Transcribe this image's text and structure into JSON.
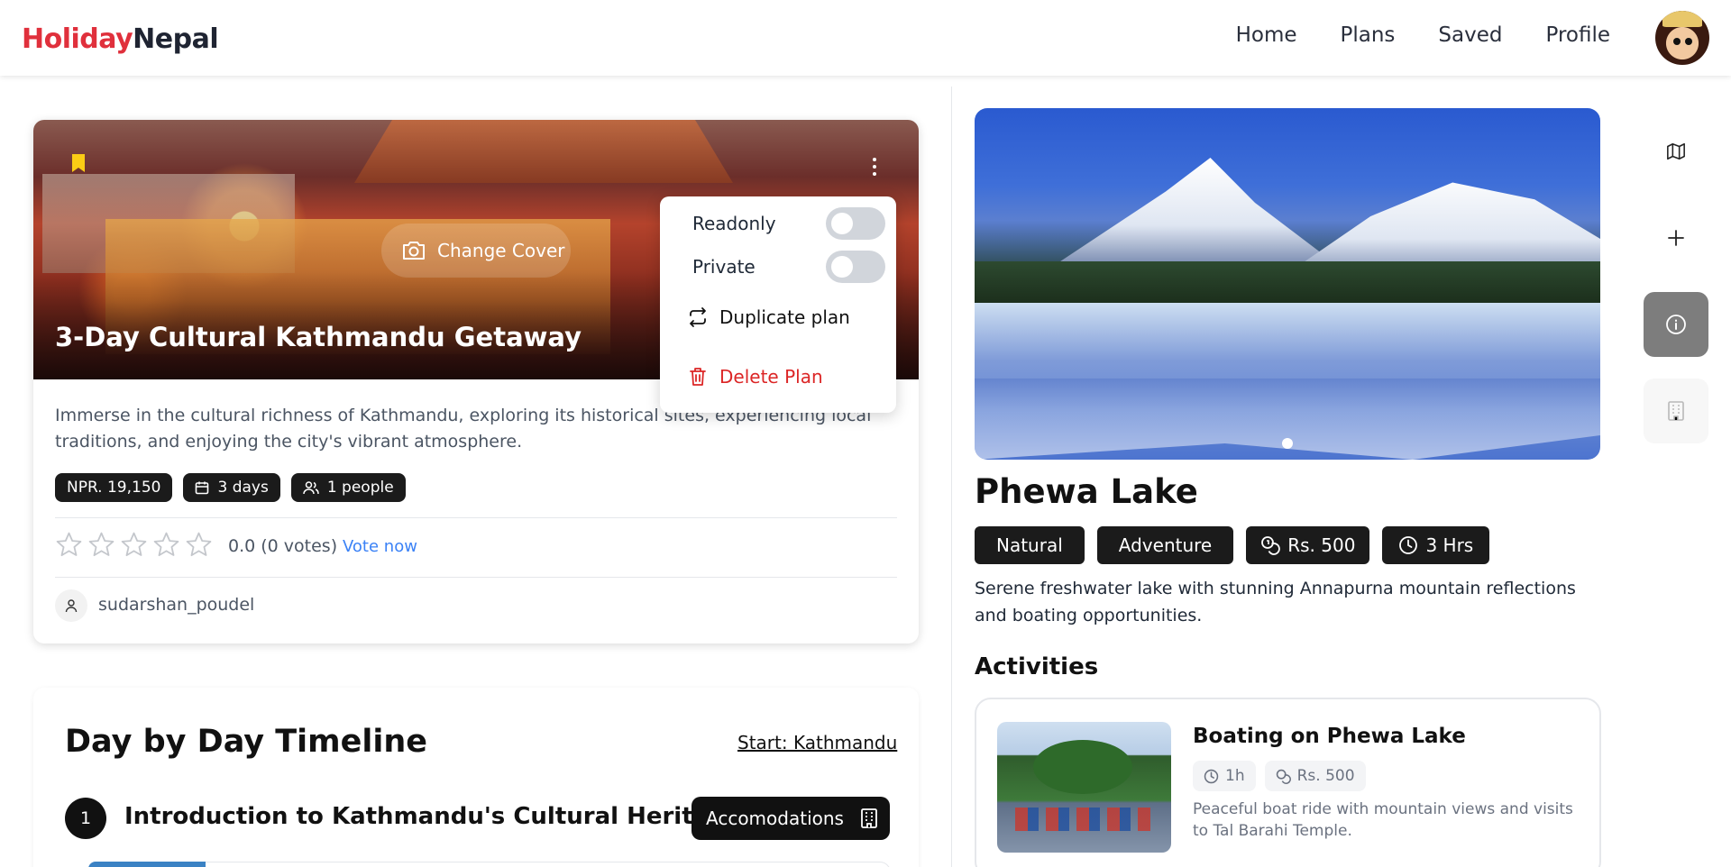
{
  "app": {
    "brand_part1": "Holiday",
    "brand_part2": "Nepal",
    "brand_red": "#e0303c"
  },
  "nav": {
    "items": [
      "Home",
      "Plans",
      "Saved",
      "Profile"
    ]
  },
  "plan": {
    "change_cover_label": "Change Cover",
    "title": "3-Day Cultural Kathmandu Getaway",
    "description": "Immerse in the cultural richness of Kathmandu, exploring its historical sites, experiencing local traditions, and enjoying the city's vibrant atmosphere.",
    "price": "NPR. 19,150",
    "duration": "3 days",
    "people": "1 people",
    "rating_text": "0.0 (0 votes)",
    "rating_value": 0,
    "vote_label": "Vote now",
    "author": "sudarshan_poudel",
    "bookmark_color": "#facc15"
  },
  "menu": {
    "readonly_label": "Readonly",
    "readonly_on": false,
    "private_label": "Private",
    "private_on": false,
    "duplicate_label": "Duplicate plan",
    "delete_label": "Delete Plan",
    "delete_color": "#dc2626"
  },
  "timeline": {
    "title": "Day by Day Timeline",
    "start_label": "Start: Kathmandu",
    "day_number": "1",
    "day_title": "Introduction to Kathmandu's Cultural Heritage",
    "accommodations_label": "Accomodations"
  },
  "place": {
    "name": "Phewa Lake",
    "tags": [
      "Natural",
      "Adventure"
    ],
    "cost": "Rs. 500",
    "duration": "3 Hrs",
    "description": "Serene freshwater lake with stunning Annapurna mountain reflections and boating opportunities.",
    "activities_heading": "Activities",
    "activity": {
      "title": "Boating on Phewa Lake",
      "duration": "1h",
      "cost": "Rs. 500",
      "description": "Peaceful boat ride with mountain views and visits to Tal Barahi Temple."
    }
  },
  "sidebar": {
    "icons": [
      "map-icon",
      "plus-icon",
      "info-icon",
      "building-icon"
    ]
  }
}
